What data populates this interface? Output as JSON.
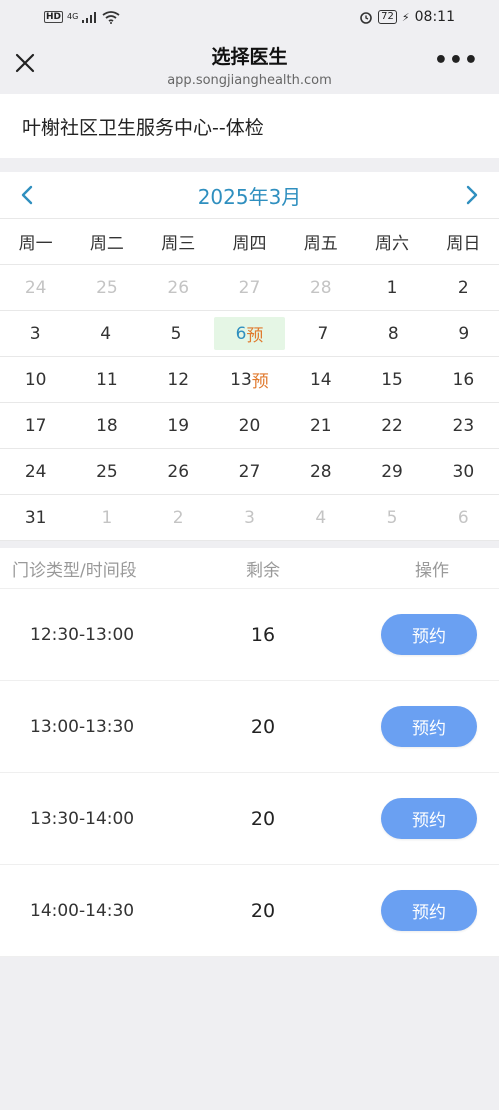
{
  "status_bar": {
    "hd": "HD",
    "network": "4G",
    "battery": "72",
    "time": "08:11"
  },
  "nav": {
    "title": "选择医生",
    "subtitle": "app.songjianghealth.com",
    "more": "•••"
  },
  "clinic_name": "叶榭社区卫生服务中心--体检",
  "calendar": {
    "month_label": "2025年3月",
    "weekdays": [
      "周一",
      "周二",
      "周三",
      "周四",
      "周五",
      "周六",
      "周日"
    ],
    "weeks": [
      [
        {
          "d": "24",
          "m": true
        },
        {
          "d": "25",
          "m": true
        },
        {
          "d": "26",
          "m": true
        },
        {
          "d": "27",
          "m": true
        },
        {
          "d": "28",
          "m": true
        },
        {
          "d": "1"
        },
        {
          "d": "2"
        }
      ],
      [
        {
          "d": "3"
        },
        {
          "d": "4"
        },
        {
          "d": "5"
        },
        {
          "d": "6",
          "tag": "预",
          "sel": true
        },
        {
          "d": "7"
        },
        {
          "d": "8"
        },
        {
          "d": "9"
        }
      ],
      [
        {
          "d": "10"
        },
        {
          "d": "11"
        },
        {
          "d": "12"
        },
        {
          "d": "13",
          "tag": "预"
        },
        {
          "d": "14"
        },
        {
          "d": "15"
        },
        {
          "d": "16"
        }
      ],
      [
        {
          "d": "17"
        },
        {
          "d": "18"
        },
        {
          "d": "19"
        },
        {
          "d": "20"
        },
        {
          "d": "21"
        },
        {
          "d": "22"
        },
        {
          "d": "23"
        }
      ],
      [
        {
          "d": "24"
        },
        {
          "d": "25"
        },
        {
          "d": "26"
        },
        {
          "d": "27"
        },
        {
          "d": "28"
        },
        {
          "d": "29"
        },
        {
          "d": "30"
        }
      ],
      [
        {
          "d": "31"
        },
        {
          "d": "1",
          "m": true
        },
        {
          "d": "2",
          "m": true
        },
        {
          "d": "3",
          "m": true
        },
        {
          "d": "4",
          "m": true
        },
        {
          "d": "5",
          "m": true
        },
        {
          "d": "6",
          "m": true
        }
      ]
    ]
  },
  "slots": {
    "headers": {
      "type": "门诊类型/时间段",
      "remain": "剩余",
      "action": "操作"
    },
    "rows": [
      {
        "time": "12:30-13:00",
        "remain": "16",
        "button": "预约"
      },
      {
        "time": "13:00-13:30",
        "remain": "20",
        "button": "预约"
      },
      {
        "time": "13:30-14:00",
        "remain": "20",
        "button": "预约"
      },
      {
        "time": "14:00-14:30",
        "remain": "20",
        "button": "预约"
      }
    ]
  },
  "colors": {
    "accent": "#2f8fbf",
    "button": "#6aa0f2",
    "tag": "#e07a2e",
    "selected_bg": "#e5f6e5"
  }
}
